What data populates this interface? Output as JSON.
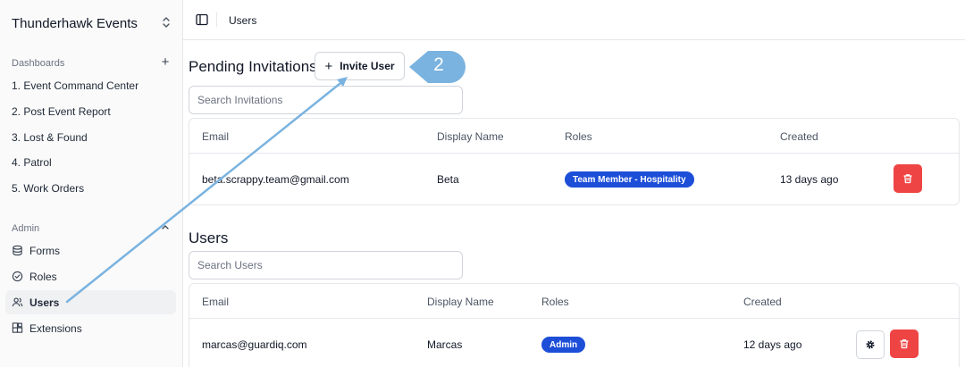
{
  "sidebar": {
    "org_name": "Thunderhawk Events",
    "org_switch_icon": "chevrons-up-down-icon",
    "dashboards_label": "Dashboards",
    "dashboards_action": "+",
    "dashboards": [
      {
        "label": "1. Event Command Center"
      },
      {
        "label": "2. Post Event Report"
      },
      {
        "label": "3. Lost & Found"
      },
      {
        "label": "4. Patrol"
      },
      {
        "label": "5. Work Orders"
      }
    ],
    "admin_label": "Admin",
    "admin_items": [
      {
        "label": "Forms",
        "icon": "database-icon"
      },
      {
        "label": "Roles",
        "icon": "check-circle-icon"
      },
      {
        "label": "Users",
        "icon": "users-icon",
        "active": true
      },
      {
        "label": "Extensions",
        "icon": "blocks-icon"
      }
    ]
  },
  "topbar": {
    "breadcrumb": "Users"
  },
  "invitations": {
    "title": "Pending Invitations",
    "invite_button": "Invite User",
    "search_placeholder": "Search Invitations",
    "columns": {
      "email": "Email",
      "display_name": "Display Name",
      "roles": "Roles",
      "created": "Created"
    },
    "rows": [
      {
        "email": "beta.scrappy.team@gmail.com",
        "display_name": "Beta",
        "role": "Team Member - Hospitality",
        "created": "13 days ago"
      }
    ]
  },
  "users": {
    "title": "Users",
    "search_placeholder": "Search Users",
    "columns": {
      "email": "Email",
      "display_name": "Display Name",
      "roles": "Roles",
      "created": "Created"
    },
    "rows": [
      {
        "email": "marcas@guardiq.com",
        "display_name": "Marcas",
        "role": "Admin",
        "created": "12 days ago"
      }
    ]
  },
  "annotation": {
    "step_number": "2"
  },
  "colors": {
    "accent_badge": "#1d4ed8",
    "danger": "#ef4444",
    "annotation": "#7ab3e0"
  }
}
